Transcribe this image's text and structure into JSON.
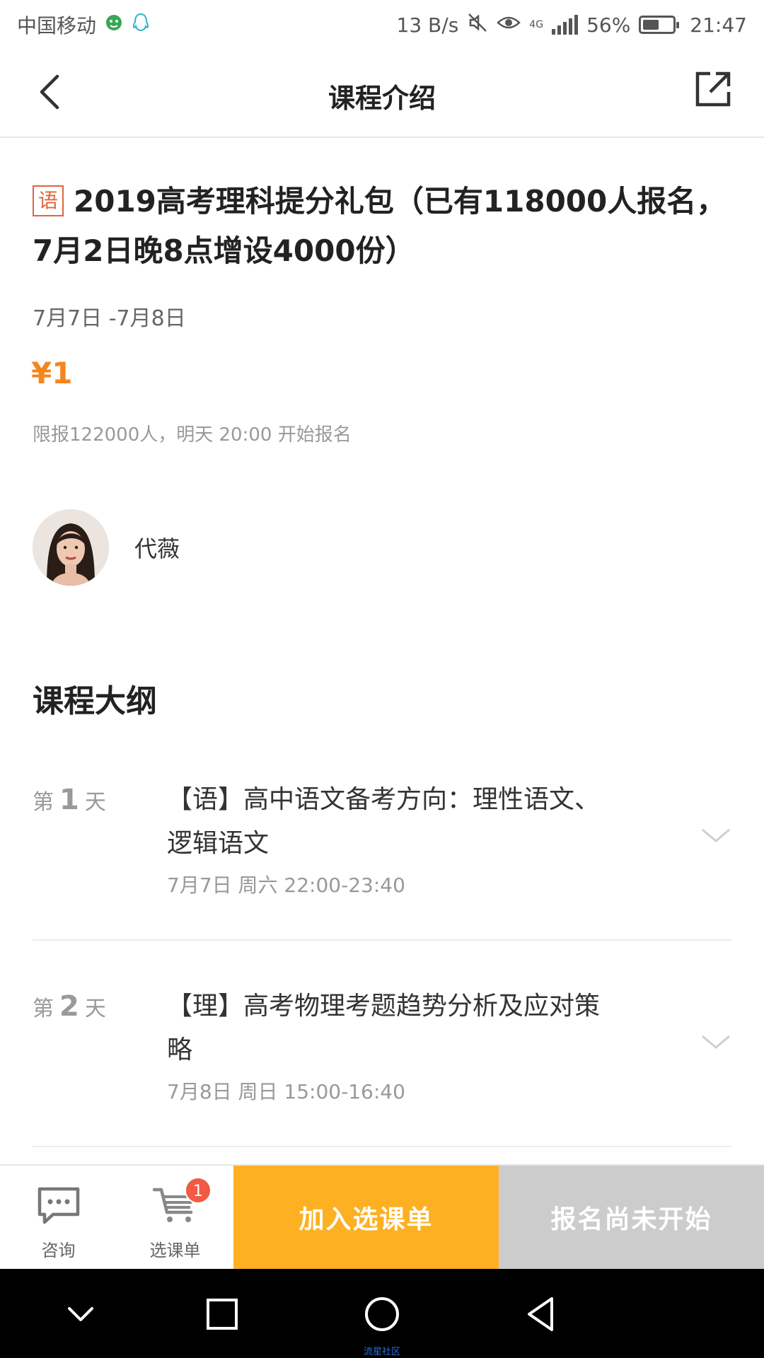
{
  "status_bar": {
    "carrier": "中国移动",
    "net_speed": "13 B/s",
    "network": "4G",
    "battery": "56%",
    "time": "21:47",
    "icons": [
      "wechat-status-icon",
      "qq-status-icon",
      "mute-icon",
      "eye-comfort-icon",
      "signal-icon",
      "battery-icon"
    ]
  },
  "header": {
    "title": "课程介绍",
    "back_icon": "back-arrow-icon",
    "share_icon": "share-icon"
  },
  "course": {
    "subject_tag": "语",
    "title": "2019高考理科提分礼包（已有118000人报名，7月2日晚8点增设4000份）",
    "dates": "7月7日 -7月8日",
    "price": "¥1",
    "enroll_note": "限报122000人，明天 20:00 开始报名",
    "accent_color": "#f4861f",
    "tag_color": "#e0643f"
  },
  "teacher": {
    "name": "代薇"
  },
  "syllabus": {
    "title": "课程大纲",
    "items": [
      {
        "day_prefix": "第",
        "day_number": "1",
        "day_suffix": "天",
        "title": "【语】高中语文备考方向：理性语文、逻辑语文",
        "time": "7月7日 周六 22:00-23:40"
      },
      {
        "day_prefix": "第",
        "day_number": "2",
        "day_suffix": "天",
        "title": "【理】高考物理考题趋势分析及应对策略",
        "time": "7月8日 周日 15:00-16:40"
      }
    ]
  },
  "action_bar": {
    "consult_label": "咨询",
    "cart_label": "选课单",
    "cart_badge": "1",
    "add_cart_label": "加入选课单",
    "enroll_label": "报名尚未开始",
    "add_cart_color": "#fdb022",
    "enroll_color": "#cccccc"
  },
  "nav_bar": {
    "watermark": "流星社区",
    "icons": [
      "nav-hide-icon",
      "nav-recents-icon",
      "nav-home-icon",
      "nav-back-icon"
    ]
  }
}
